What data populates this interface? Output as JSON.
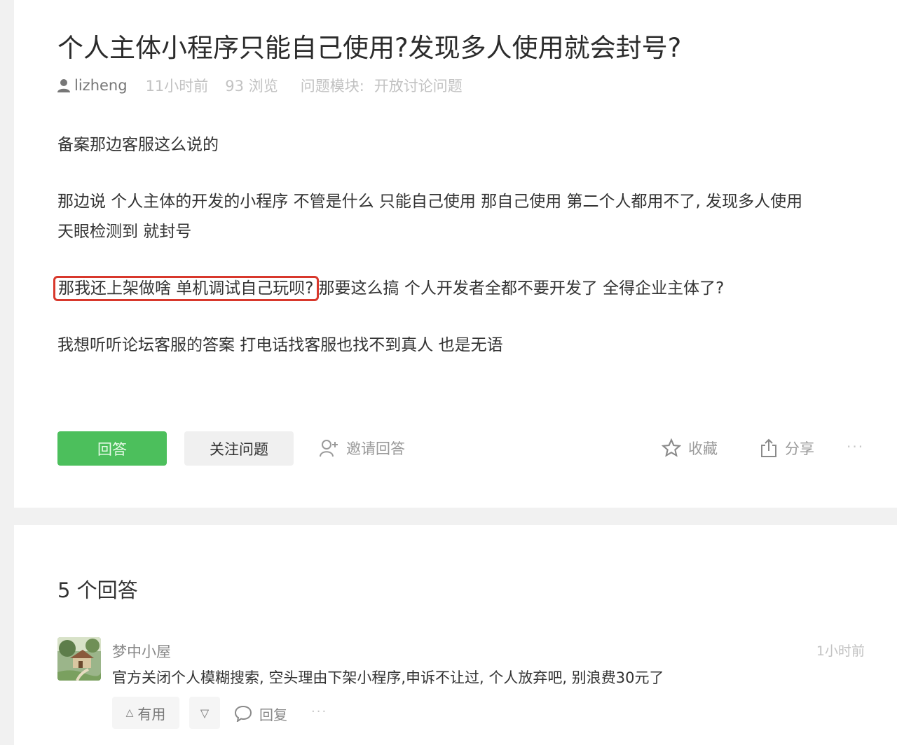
{
  "question": {
    "title": "个人主体小程序只能自己使用?发现多人使用就会封号?",
    "author": "lizheng",
    "time": "11小时前",
    "views": "93 浏览",
    "module_label": "问题模块:",
    "module_value": "开放讨论问题",
    "paragraphs": {
      "p1": "备案那边客服这么说的",
      "p2_line1": "那边说 个人主体的开发的小程序 不管是什么 只能自己使用 那自己使用 第二个人都用不了, 发现多人使用",
      "p2_line2": "天眼检测到 就封号",
      "p3_highlight": "那我还上架做啥 单机调试自己玩呗?",
      "p3_rest": "那要这么搞 个人开发者全都不要开发了 全得企业主体了?",
      "p4": "我想听听论坛客服的答案 打电话找客服也找不到真人 也是无语"
    },
    "actions": {
      "answer": "回答",
      "follow": "关注问题",
      "invite": "邀请回答",
      "favorite": "收藏",
      "share": "分享",
      "more": "···"
    }
  },
  "answers": {
    "count_label": "5 个回答",
    "items": [
      {
        "author": "梦中小屋",
        "time": "1小时前",
        "content": "官方关闭个人模糊搜索, 空头理由下架小程序,申诉不让过, 个人放弃吧, 别浪费30元了",
        "useful": "有用",
        "reply": "回复",
        "more": "···"
      }
    ]
  },
  "colors": {
    "accent_green": "#4cbf5c",
    "highlight_red": "#d8382c"
  }
}
